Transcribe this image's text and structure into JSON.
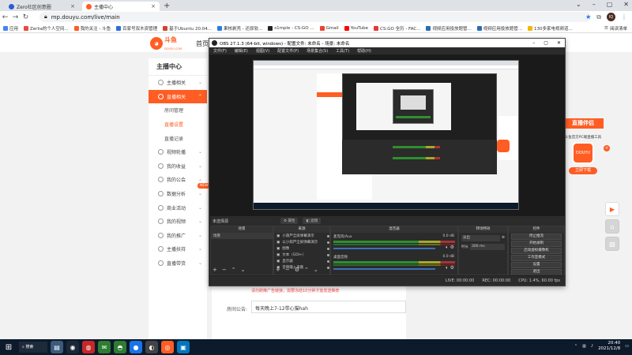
{
  "browser": {
    "tabs": [
      {
        "title": "Zero社区创意圈"
      },
      {
        "title": "主播中心"
      }
    ],
    "new_tab": "+",
    "url": "mp.douyu.com/live/main",
    "bookmarks": [
      {
        "label": "应用",
        "color": "#4285f4"
      },
      {
        "label": "Zerlia的个人空间...",
        "color": "#e74c3c"
      },
      {
        "label": "我的关注 - 斗鱼",
        "color": "#ff5d23"
      },
      {
        "label": "百家号双木资管理",
        "color": "#2c6fd8"
      },
      {
        "label": "基于Ubuntu 20.04...",
        "color": "#d2452c"
      },
      {
        "label": "果核剥壳 - 还原软...",
        "color": "#2a7de1"
      },
      {
        "label": "s1mple - CS:GO ...",
        "color": "#222222"
      },
      {
        "label": "Gmail",
        "color": "#ea4335"
      },
      {
        "label": "YouTube",
        "color": "#ff0000"
      },
      {
        "label": "CS:GO 全历 - FAC...",
        "color": "#e53935"
      },
      {
        "label": "视频应用投放题管...",
        "color": "#2b6cb0"
      },
      {
        "label": "视频应用投放题管...",
        "color": "#2b6cb0"
      },
      {
        "label": "130多家电视频道...",
        "color": "#f2b705"
      }
    ],
    "bookmarks_right": "阅读清单"
  },
  "site": {
    "logo_text": "斗鱼",
    "logo_sub": "DOUYU.COM",
    "home_link": "首页",
    "sidebar_title": "主播中心",
    "sidebar": [
      {
        "label": "主播相关",
        "type": "group"
      },
      {
        "label": "直播相关",
        "type": "group-active"
      },
      {
        "label": "房间管理",
        "type": "sub"
      },
      {
        "label": "直播设置",
        "type": "sub-selected"
      },
      {
        "label": "直播记录",
        "type": "sub"
      },
      {
        "label": "视频轮播",
        "type": "group"
      },
      {
        "label": "我的收益",
        "type": "group"
      },
      {
        "label": "我的公会",
        "type": "group"
      },
      {
        "label": "数据分析",
        "type": "group"
      },
      {
        "label": "商业活动",
        "type": "group"
      },
      {
        "label": "我的视频",
        "type": "group"
      },
      {
        "label": "我的推广",
        "type": "group"
      },
      {
        "label": "主播扶持",
        "type": "group"
      },
      {
        "label": "直播带货",
        "type": "group"
      }
    ],
    "new_badge": "NEW",
    "warning": "请勿刷推广告链接，需要冻结10分钟才能发送推荐",
    "notice_label": "房间公告:",
    "notice_value": "每天晚上7-12带心猫hah",
    "promo": {
      "title": "直播伴侣",
      "sub": "斗鱼官方PC端直播工具",
      "app_text": "DOUYU",
      "download": "立即下载",
      "close": "×"
    }
  },
  "obs": {
    "title": "OBS 27.1.3 (64-bit, windows) - 配置文件: 未命名 - 场景: 未命名",
    "menu": [
      "文件(F)",
      "编辑(E)",
      "视图(V)",
      "配置文件(P)",
      "场景集合(S)",
      "工具(T)",
      "帮助(H)"
    ],
    "scene_bar_label": "未选择源",
    "scene_bar_props": "属性",
    "scene_bar_filters": "滤镜",
    "docks": {
      "scenes": {
        "title": "场景",
        "items": [
          "场景"
        ]
      },
      "sources": {
        "title": "来源",
        "items": [
          "小葫芦全屏弹幕演示",
          "以小葫芦全屏弹幕演示",
          "图像",
          "文本（GDI+）",
          "显示器",
          "音频输入采集"
        ]
      },
      "mixer": {
        "title": "混音器",
        "channels": [
          {
            "name": "麦克风/Aux",
            "db": "0.0 dB"
          },
          {
            "name": "桌面音频",
            "db": "0.0 dB"
          }
        ]
      },
      "transitions": {
        "title": "转场特效",
        "type": "淡出",
        "duration_label": "时长",
        "duration": "300 ms"
      },
      "controls": {
        "title": "控件",
        "buttons": [
          "停止推流",
          "开始录制",
          "启动虚拟摄像机",
          "工作室模式",
          "设置",
          "退出"
        ]
      }
    },
    "status": {
      "live": "LIVE: 00:00:00",
      "rec": "REC: 00:00:00",
      "cpu": "CPU: 1.4%, 60.00 fps"
    }
  },
  "taskbar": {
    "search_label": "⌕ 搜索",
    "apps": [
      {
        "glyph": "▤",
        "color": "#3b5b7d"
      },
      {
        "glyph": "◉",
        "color": "#1b2838"
      },
      {
        "glyph": "◍",
        "color": "#c62828"
      },
      {
        "glyph": "✉",
        "color": "#2e7d32"
      },
      {
        "glyph": "◓",
        "color": "#2e7d32"
      },
      {
        "glyph": "●",
        "color": "#1a73e8"
      },
      {
        "glyph": "◐",
        "color": "#444444"
      },
      {
        "glyph": "◎",
        "color": "#ff5d23"
      },
      {
        "glyph": "▣",
        "color": "#0277bd"
      }
    ],
    "time": "20:40",
    "date": "2021/12/8"
  }
}
